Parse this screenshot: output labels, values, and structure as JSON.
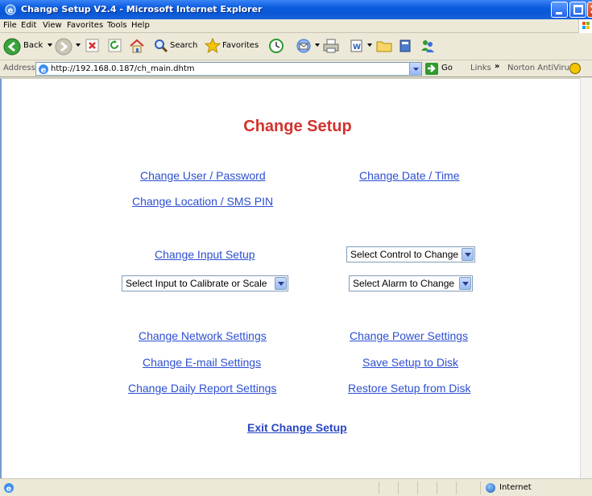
{
  "window": {
    "title": "Change Setup V2.4 - Microsoft Internet Explorer"
  },
  "menubar": {
    "items": [
      "File",
      "Edit",
      "View",
      "Favorites",
      "Tools",
      "Help"
    ]
  },
  "toolbar": {
    "back_label": "Back",
    "search_label": "Search",
    "favorites_label": "Favorites"
  },
  "addressbar": {
    "label": "Address",
    "url": "http://192.168.0.187/ch_main.dhtm",
    "go_label": "Go",
    "links_label": "Links",
    "overflow": "»",
    "norton_label": "Norton AntiVirus"
  },
  "page": {
    "title": "Change Setup",
    "links": {
      "user_password": "Change User / Password",
      "date_time": "Change Date / Time",
      "location_sms": "Change Location / SMS PIN",
      "input_setup": "Change Input Setup",
      "network_settings": "Change Network Settings",
      "power_settings": "Change Power Settings",
      "email_settings": "Change E-mail Settings",
      "save_setup": "Save Setup to Disk",
      "daily_report": "Change Daily Report Settings",
      "restore_setup": "Restore Setup from Disk",
      "exit": "Exit Change Setup"
    },
    "selects": {
      "control": "Select Control to Change",
      "input_calibrate": "Select Input to Calibrate or Scale",
      "alarm": "Select Alarm to Change"
    }
  },
  "statusbar": {
    "zone": "Internet"
  },
  "colors": {
    "title_red": "#d2322d",
    "link_blue": "#2c4fd1",
    "xp_blue": "#0a5bde"
  }
}
